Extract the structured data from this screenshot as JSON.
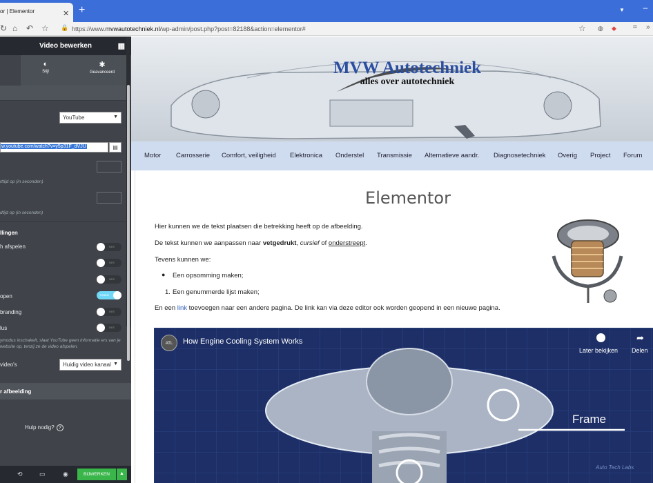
{
  "browser": {
    "tab_title": "or | Elementor",
    "tab_close": "✕",
    "new_tab": "+",
    "url_prefix": "https://www.",
    "url_host": "mvwautotechniek.nl",
    "url_path": "/wp-admin/post.php?post=82188&action=elementor#"
  },
  "panel": {
    "title": "Video bewerken",
    "tabs": [
      {
        "label": "",
        "icon": "content-icon"
      },
      {
        "label": "Stijl",
        "icon": "contrast-icon"
      },
      {
        "label": "Geavanceerd",
        "icon": "gear-icon"
      }
    ],
    "source_value": "YouTube",
    "link_value": "w.youtube.com/watch?v=y5p31F_dVJU",
    "start_hint": "rttijd op (in seconden)",
    "end_hint": "dtijd op (in seconden)",
    "settings_title": "llingen",
    "toggles": [
      {
        "label": "h afspelen",
        "state": "NEE",
        "on": false
      },
      {
        "label": "",
        "state": "NEE",
        "on": false
      },
      {
        "label": "",
        "state": "NEE",
        "on": false
      },
      {
        "label": "open",
        "state": "TONEN",
        "on": true
      },
      {
        "label": "branding",
        "state": "NEE",
        "on": false
      },
      {
        "label": "lus",
        "state": "NEE",
        "on": false
      }
    ],
    "privacy_hint": "ymodus inschakelt, slaat YouTube geen informatie ers van je website op, tenzij ze de video afspelen.",
    "related_label": "video's",
    "related_value": "Huidig video kanaal",
    "image_section": "r afbeelding",
    "help": "Hulp nodig?",
    "help_q": "?",
    "publish": "BIJWERKEN"
  },
  "site": {
    "logo_title": "MVW Autotechniek",
    "logo_sub": "alles over autotechniek",
    "nav": [
      "Motor",
      "Carrosserie",
      "Comfort, veiligheid",
      "Elektronica",
      "Onderstel",
      "Transmissie",
      "Alternatieve aandr.",
      "Diagnosetechniek",
      "Overig",
      "Project",
      "Forum"
    ],
    "heading": "Elementor",
    "p1": "Hier kunnen we de tekst plaatsen die betrekking heeft op de afbeelding.",
    "p2_a": "De tekst kunnen we aanpassen naar ",
    "p2_bold": "vetgedrukt",
    "p2_b": ", ",
    "p2_italic": "cursief",
    "p2_c": " of ",
    "p2_under": "onderstreept",
    "p2_d": ".",
    "p3": "Tevens kunnen we:",
    "li1": "Een opsomming maken;",
    "li2_num": "1.",
    "li2": "Een genummerde lijst maken;",
    "p4_a": "En een ",
    "p4_link": "link",
    "p4_b": " toevoegen naar een andere pagina. De link kan via deze editor ook worden geopend in een nieuwe pagina.",
    "video": {
      "channel_badge": "ATL",
      "title": "How Engine Cooling System Works",
      "watch_later": "Later bekijken",
      "share": "Delen",
      "frame_label": "Frame",
      "watermark": "Auto Tech Labs"
    }
  }
}
